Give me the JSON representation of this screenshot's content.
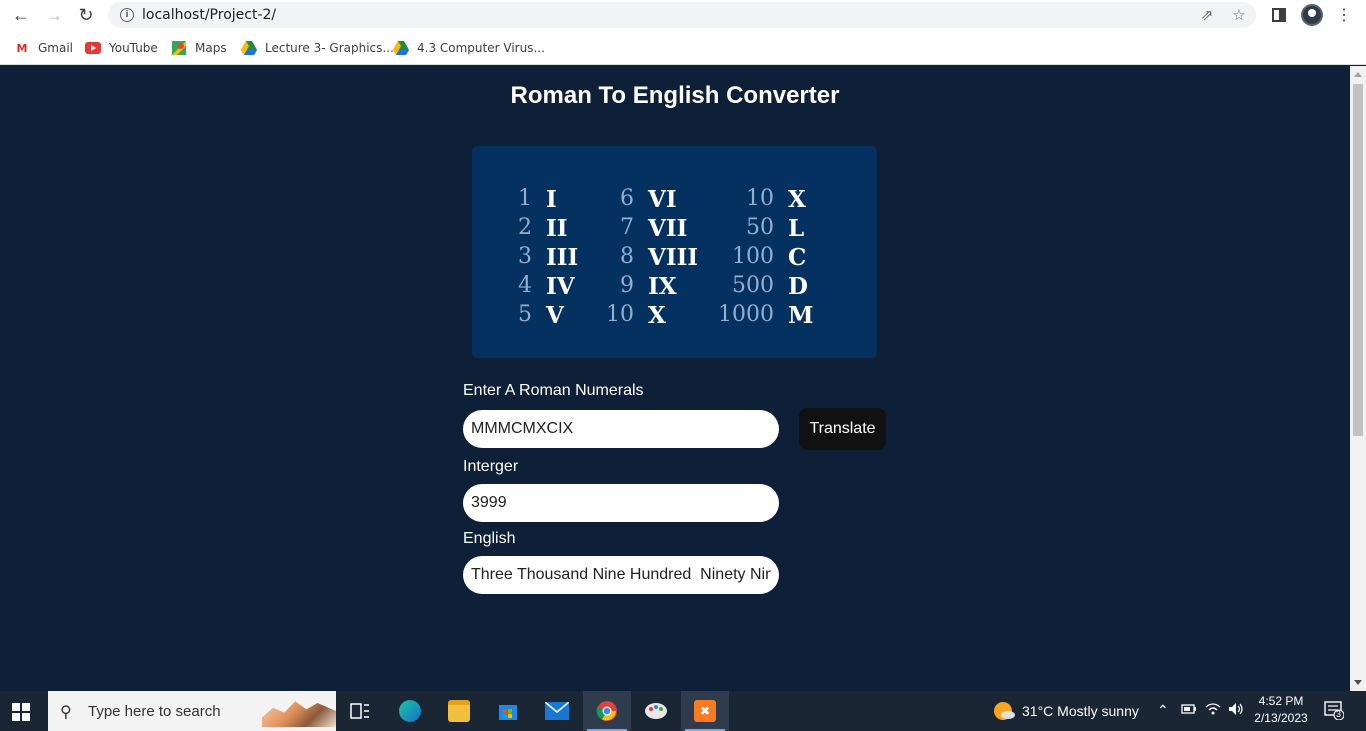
{
  "browser": {
    "url": "localhost/Project-2/",
    "bookmarks": [
      {
        "label": "Gmail",
        "icon": "gmail-icon"
      },
      {
        "label": "YouTube",
        "icon": "youtube-icon"
      },
      {
        "label": "Maps",
        "icon": "maps-icon"
      },
      {
        "label": "Lecture 3- Graphics...",
        "icon": "drive-icon"
      },
      {
        "label": "4.3 Computer Virus...",
        "icon": "drive-icon"
      }
    ]
  },
  "page": {
    "title": "Roman To English Converter",
    "reference": [
      {
        "num": "1",
        "roman": "I"
      },
      {
        "num": "2",
        "roman": "II"
      },
      {
        "num": "3",
        "roman": "III"
      },
      {
        "num": "4",
        "roman": "IV"
      },
      {
        "num": "5",
        "roman": "V"
      },
      {
        "num": "6",
        "roman": "VI"
      },
      {
        "num": "7",
        "roman": "VII"
      },
      {
        "num": "8",
        "roman": "VIII"
      },
      {
        "num": "9",
        "roman": "IX"
      },
      {
        "num": "10",
        "roman": "X"
      },
      {
        "num": "10",
        "roman": "X"
      },
      {
        "num": "50",
        "roman": "L"
      },
      {
        "num": "100",
        "roman": "C"
      },
      {
        "num": "500",
        "roman": "D"
      },
      {
        "num": "1000",
        "roman": "M"
      }
    ],
    "roman_label": "Enter A Roman Numerals",
    "roman_value": "MMMCMXCIX",
    "translate_label": "Translate",
    "integer_label": "Interger",
    "integer_value": "3999",
    "english_label": "English",
    "english_value": "Three Thousand Nine Hundred  Ninety Nine"
  },
  "taskbar": {
    "search_placeholder": "Type here to search",
    "weather": "31°C  Mostly sunny",
    "time": "4:52 PM",
    "date": "2/13/2023",
    "notification_count": "3"
  }
}
